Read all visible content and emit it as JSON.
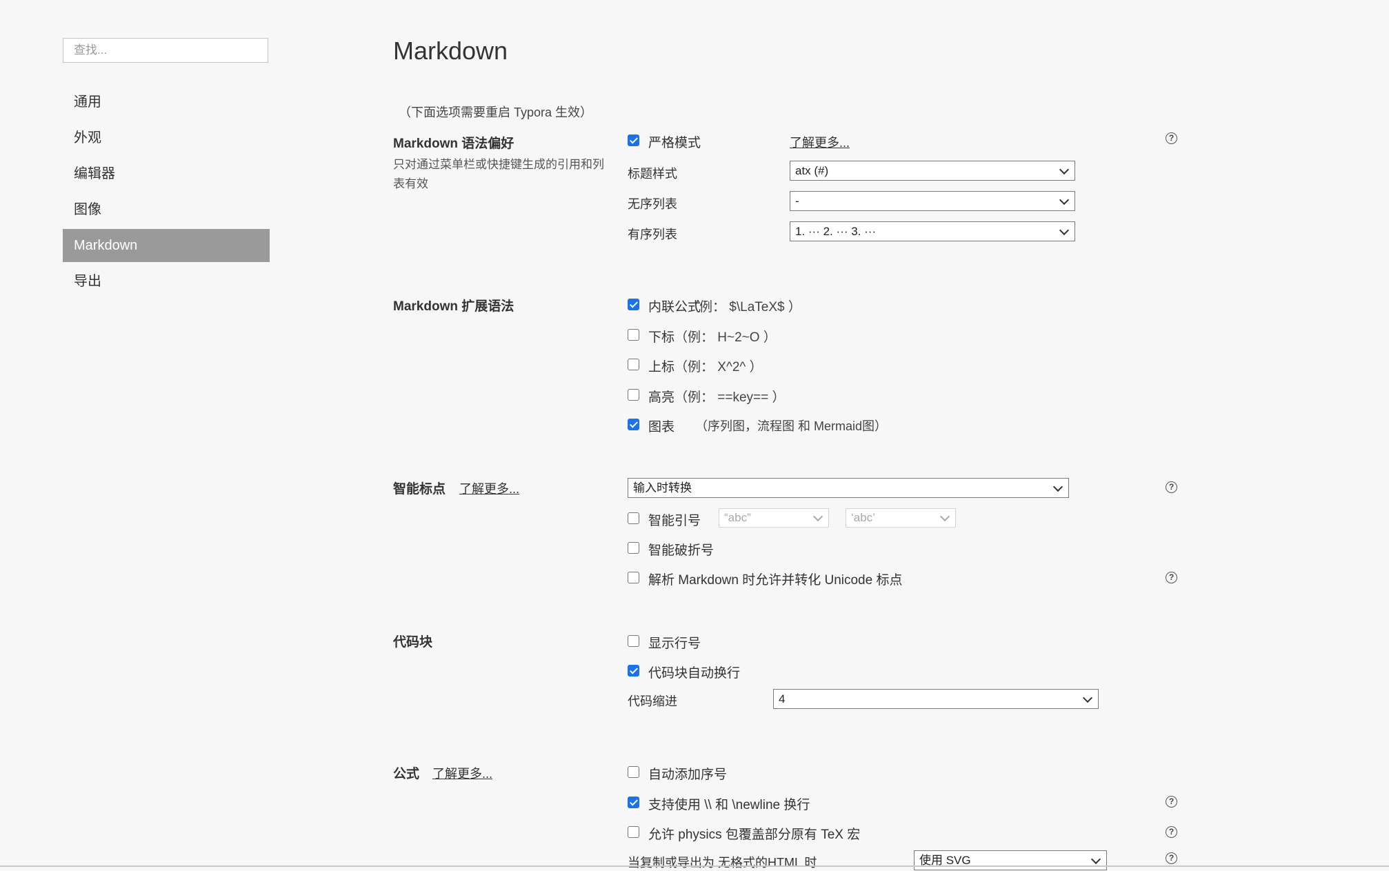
{
  "search": {
    "placeholder": "查找..."
  },
  "sidebar": {
    "items": [
      {
        "label": "通用"
      },
      {
        "label": "外观"
      },
      {
        "label": "编辑器"
      },
      {
        "label": "图像"
      },
      {
        "label": "Markdown",
        "active": true
      },
      {
        "label": "导出"
      }
    ]
  },
  "page": {
    "title": "Markdown",
    "note": "（下面选项需要重启 Typora 生效）"
  },
  "syntax_pref": {
    "title": "Markdown 语法偏好",
    "desc": "只对通过菜单栏或快捷键生成的引用和列表有效",
    "strict_mode": {
      "label": "严格模式",
      "checked": true
    },
    "learn_more": "了解更多...",
    "heading_style": {
      "label": "标题样式",
      "value": "atx (#)"
    },
    "unordered_list": {
      "label": "无序列表",
      "value": "-"
    },
    "ordered_list": {
      "label": "有序列表",
      "value": "1. ··· 2. ··· 3. ···"
    }
  },
  "extended": {
    "title": "Markdown 扩展语法",
    "inline_math": {
      "label": "内联公式",
      "example": "（例：  $\\LaTeX$ ）",
      "checked": true
    },
    "subscript": {
      "label": "下标",
      "example": "（例：  H~2~O ）",
      "checked": false
    },
    "superscript": {
      "label": "上标",
      "example": "（例：  X^2^ ）",
      "checked": false
    },
    "highlight": {
      "label": "高亮",
      "example": "（例：  ==key== ）",
      "checked": false
    },
    "diagrams": {
      "label": "图表",
      "example": "（序列图，流程图 和 Mermaid图）",
      "checked": true
    }
  },
  "smart_punct": {
    "title": "智能标点",
    "learn_more": "了解更多...",
    "mode": {
      "value": "输入时转换"
    },
    "smart_quotes": {
      "label": "智能引号",
      "checked": false,
      "double": "“abc”",
      "single": "‘abc’"
    },
    "smart_dashes": {
      "label": "智能破折号",
      "checked": false
    },
    "unicode": {
      "label": "解析 Markdown 时允许并转化 Unicode 标点",
      "checked": false
    }
  },
  "code_block": {
    "title": "代码块",
    "line_numbers": {
      "label": "显示行号",
      "checked": false
    },
    "wrap": {
      "label": "代码块自动换行",
      "checked": true
    },
    "indent": {
      "label": "代码缩进",
      "value": "4"
    }
  },
  "math": {
    "title": "公式",
    "learn_more": "了解更多...",
    "auto_number": {
      "label": "自动添加序号",
      "checked": false
    },
    "newline": {
      "label": "支持使用 \\\\ 和 \\newline 换行",
      "checked": true
    },
    "physics": {
      "label": "允许 physics 包覆盖部分原有 TeX 宏",
      "checked": false
    },
    "export": {
      "label": "当复制或导出为 无格式的HTML 时",
      "value": "使用 SVG"
    }
  },
  "icons": {
    "help": "?"
  },
  "colors": {
    "accent": "#1a73e8",
    "active_nav": "#9a9a9a",
    "background": "#f7f7f7"
  }
}
